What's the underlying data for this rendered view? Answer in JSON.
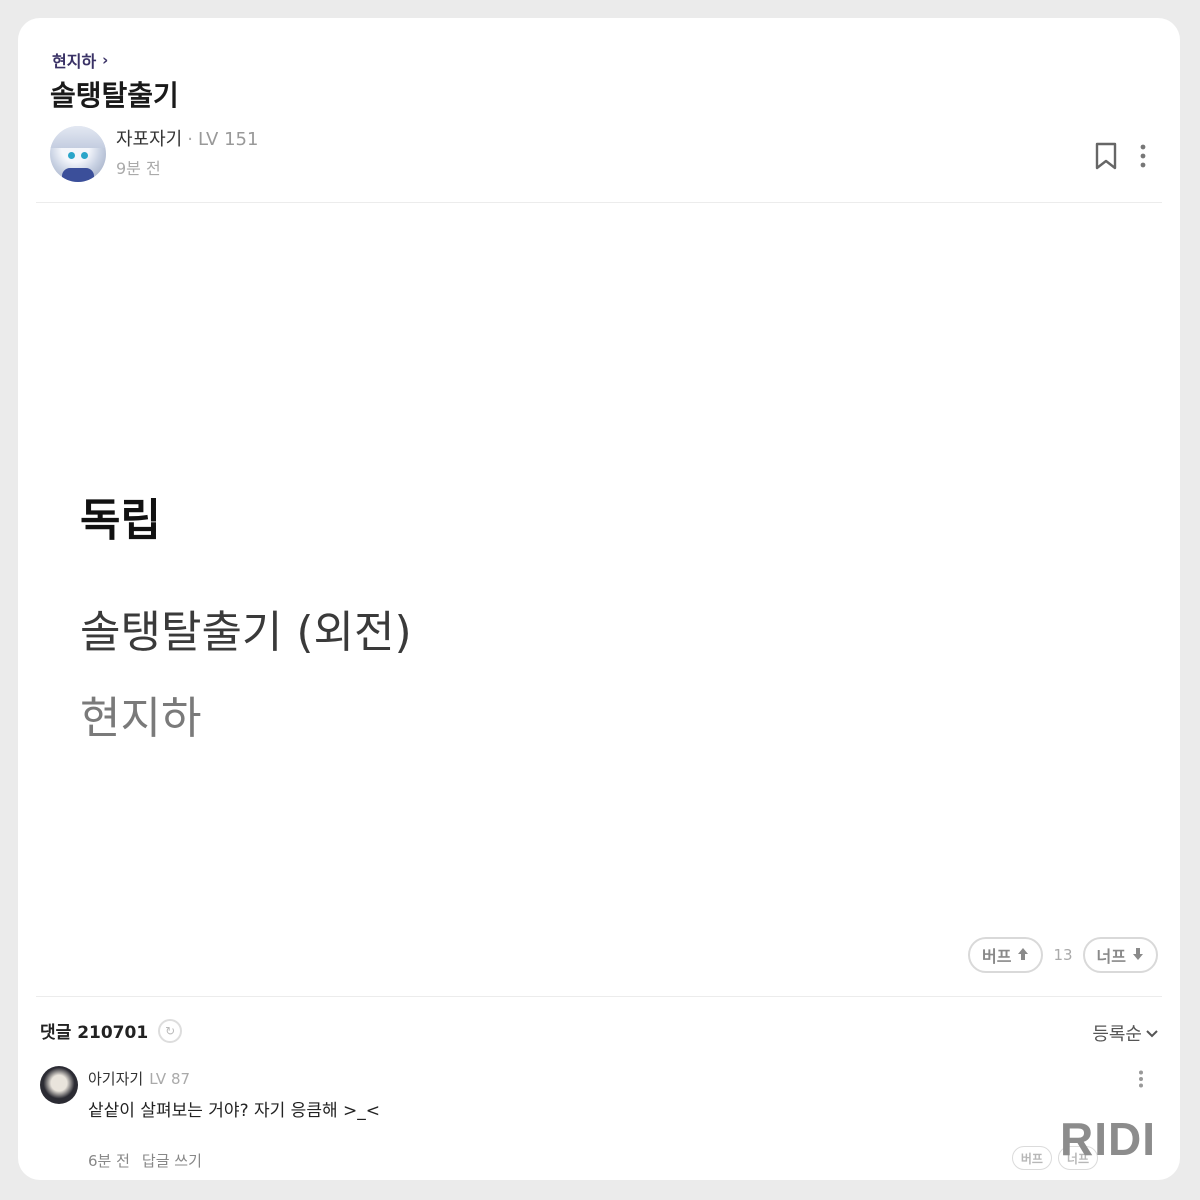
{
  "breadcrumb": {
    "label": "현지하",
    "chevron": "›"
  },
  "post": {
    "title": "솔탱탈출기",
    "author": {
      "name": "자포자기",
      "separator": "·",
      "level": "LV 151",
      "time": "9분 전"
    },
    "actions": {
      "bookmark_icon": "bookmark-icon",
      "more_icon": "more-vertical-icon"
    },
    "body": {
      "line1": "독립",
      "line2": "솔탱탈출기 (외전)",
      "line3": "현지하"
    },
    "votes": {
      "up_label": "버프",
      "up_icon": "↑",
      "count": "13",
      "down_label": "너프",
      "down_icon": "↓"
    }
  },
  "comments": {
    "title": "댓글 210701",
    "refresh_icon": "↻",
    "sort_label": "등록순",
    "sort_icon": "⌄",
    "items": [
      {
        "author": "아기자기",
        "level": "LV 87",
        "text": "샅샅이 살펴보는 거야? 자기 응큼해 >_<",
        "time": "6분 전",
        "reply_label": "답글 쓰기",
        "up_label": "버프",
        "down_label": "너프"
      }
    ]
  },
  "watermark": "RIDI",
  "colors": {
    "breadcrumb": "#3a3266",
    "background": "#ebebeb",
    "card": "#ffffff"
  }
}
